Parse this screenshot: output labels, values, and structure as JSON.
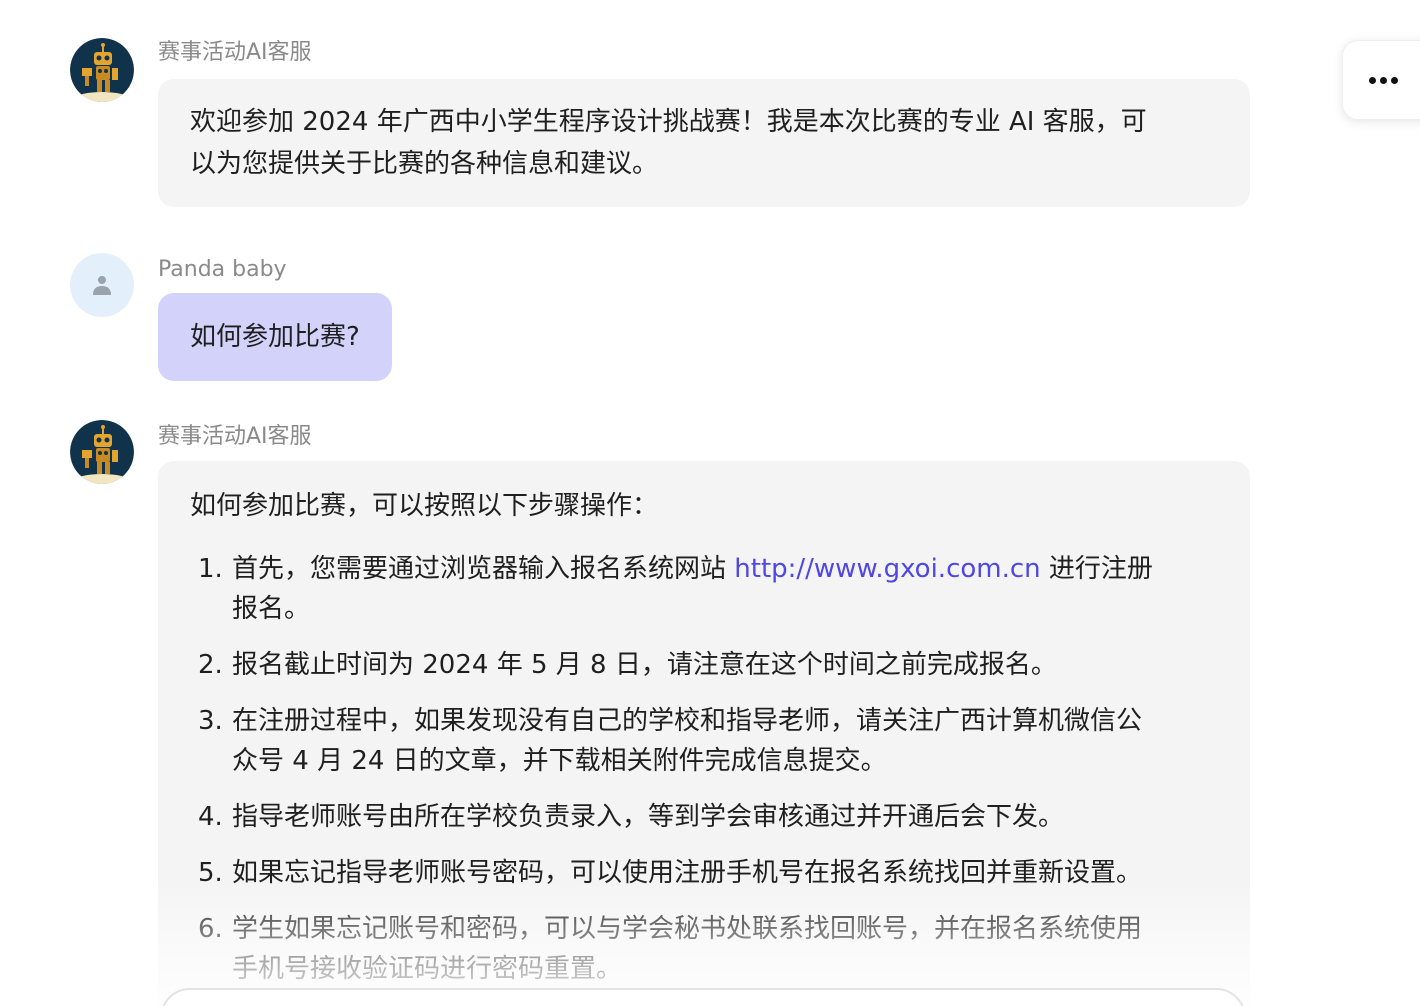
{
  "messages": [
    {
      "sender": "赛事活动AI客服",
      "role": "bot",
      "avatar_icon": "robot-avatar-icon",
      "text_lines": [
        "欢迎参加 2024 年广西中小学生程序设计挑战赛！我是本次比赛的专业 AI 客服，可",
        "以为您提供关于比赛的各种信息和建议。"
      ]
    },
    {
      "sender": "Panda baby",
      "role": "user",
      "avatar_icon": "user-avatar-icon",
      "text": "如何参加比赛?"
    },
    {
      "sender": "赛事活动AI客服",
      "role": "bot",
      "avatar_icon": "robot-avatar-icon",
      "intro": "如何参加比赛，可以按照以下步骤操作：",
      "steps": [
        {
          "number": "1.",
          "line1_before_link": "首先，您需要通过浏览器输入报名系统网站 ",
          "link": "http://www.gxoi.com.cn",
          "line1_after_link": " 进行注册",
          "line2": "报名。"
        },
        {
          "number": "2.",
          "line1": "报名截止时间为 2024 年 5 月 8 日，请注意在这个时间之前完成报名。"
        },
        {
          "number": "3.",
          "line1": "在注册过程中，如果发现没有自己的学校和指导老师，请关注广西计算机微信公",
          "line2": "众号 4 月 24 日的文章，并下载相关附件完成信息提交。"
        },
        {
          "number": "4.",
          "line1": "指导老师账号由所在学校负责录入，等到学会审核通过并开通后会下发。"
        },
        {
          "number": "5.",
          "line1": "如果忘记指导老师账号密码，可以使用注册手机号在报名系统找回并重新设置。"
        },
        {
          "number": "6.",
          "line1": "学生如果忘记账号和密码，可以与学会秘书处联系找回账号，并在报名系统使用",
          "line2": "手机号接收验证码进行密码重置。"
        }
      ]
    }
  ],
  "colors": {
    "bot_bubble": "#f4f4f4",
    "user_bubble": "#d3d2fb",
    "link": "#4f46e5",
    "sender_name": "#8a8a8a"
  },
  "more_button_icon": "more-horizontal-icon"
}
